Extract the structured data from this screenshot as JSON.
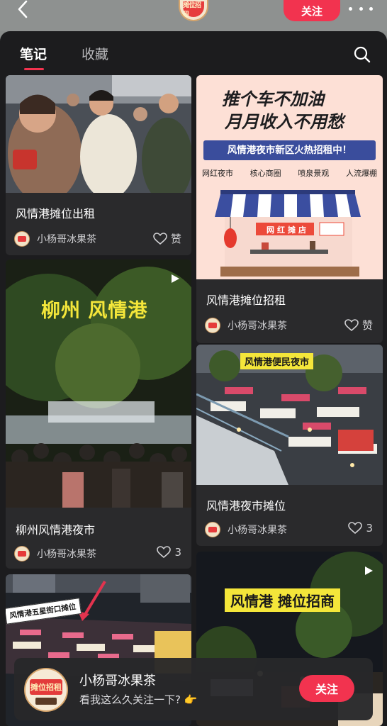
{
  "header": {
    "follow_label": "关注",
    "avatar_text": "摊位招租"
  },
  "tabs": [
    {
      "label": "笔记",
      "active": true
    },
    {
      "label": "收藏",
      "active": false
    }
  ],
  "notes": [
    {
      "title": "风情港摊位出租",
      "author": "小杨哥冰果茶",
      "likes": "赞",
      "image": "crowd-eating-photo"
    },
    {
      "title": "风情港摊位招租",
      "author": "小杨哥冰果茶",
      "likes": "赞",
      "image": "stall-rental-poster",
      "poster": {
        "headline1": "推个车不加油",
        "headline2": "月月收入不用愁",
        "banner": "风情港夜市新区火热招租中！",
        "tags": [
          "网红夜市",
          "核心商圈",
          "喷泉景观",
          "人流爆棚"
        ],
        "stall_sign": "网红摊店"
      }
    },
    {
      "title": "柳州风情港夜市",
      "author": "小杨哥冰果茶",
      "likes": "3",
      "image": "night-market-crowd",
      "overlay": "柳州 风情港"
    },
    {
      "title": "风情港夜市摊位",
      "author": "小杨哥冰果茶",
      "likes": "3",
      "image": "night-market-aerial",
      "overlay": "风情港便民夜市"
    },
    {
      "title": "",
      "author": "",
      "likes": "",
      "image": "night-market-street",
      "overlay": "风情港五星街口摊位"
    },
    {
      "title": "",
      "author": "",
      "likes": "",
      "image": "stall-merchant-night",
      "overlay": "风情港 摊位招商"
    }
  ],
  "banner": {
    "name": "小杨哥冰果茶",
    "subtitle": "看我这么久关注一下? 👉",
    "follow_label": "关注",
    "avatar_text": "摊位招租"
  },
  "colors": {
    "accent": "#f2334f",
    "panel_bg": "#1c1c1e",
    "card_bg": "#2a2a2c"
  }
}
